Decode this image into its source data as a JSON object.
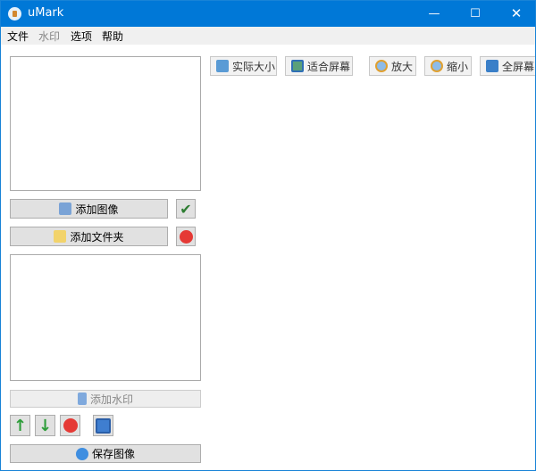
{
  "window": {
    "title": "uMark",
    "controls": [
      "minimize",
      "maximize",
      "close"
    ]
  },
  "menu": [
    "文件",
    "水印",
    "选项",
    "帮助"
  ],
  "left": {
    "add_image": "添加图像",
    "add_folder": "添加文件夹",
    "add_watermark": "添加水印",
    "save_image": "保存图像"
  },
  "toolbar": {
    "actual_size": "实际大小",
    "fit_screen": "适合屏幕",
    "zoom_in": "放大",
    "zoom_out": "缩小",
    "fullscreen": "全屏幕"
  },
  "colors": {
    "titlebar": "#0078d7",
    "menubar": "#f0f0f0"
  }
}
